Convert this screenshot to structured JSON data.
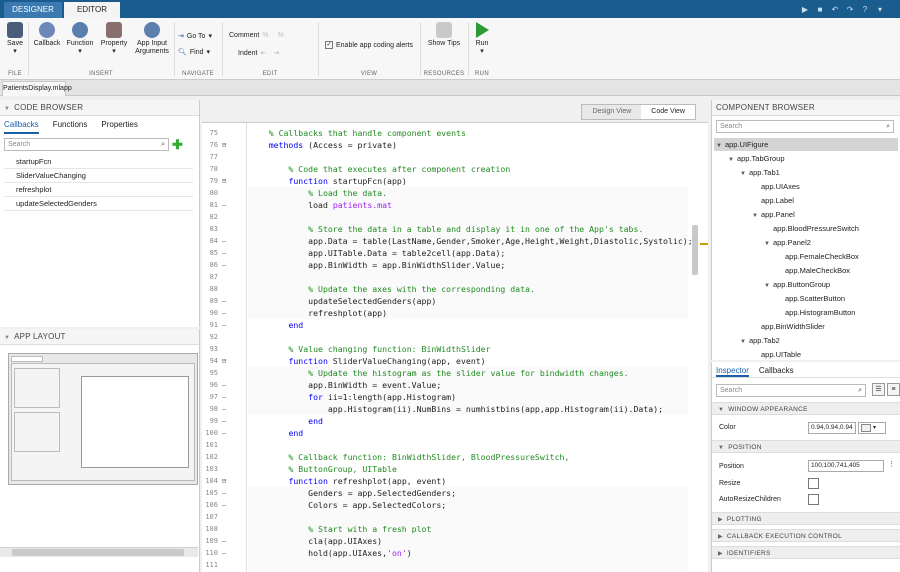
{
  "ribbon_tabs": {
    "designer": "DESIGNER",
    "editor": "EDITOR"
  },
  "ribbon": {
    "save": "Save",
    "callback": "Callback",
    "function": "Function",
    "property": "Property",
    "app_input_1": "App Input",
    "app_input_2": "Arguments",
    "go_to": "Go To",
    "find": "Find",
    "comment": "Comment",
    "indent": "Indent",
    "coding_alerts": "Enable app coding alerts",
    "show_tips": "Show Tips",
    "run": "Run",
    "groups": {
      "file": "FILE",
      "insert": "INSERT",
      "navigate": "NAVIGATE",
      "edit": "EDIT",
      "view": "VIEW",
      "resources": "RESOURCES",
      "run": "RUN"
    }
  },
  "document_tab": "PatientsDisplay.mlapp",
  "code_browser": {
    "title": "CODE BROWSER",
    "tabs": [
      "Callbacks",
      "Functions",
      "Properties"
    ],
    "search_placeholder": "Search",
    "items": [
      "startupFcn",
      "SliderValueChanging",
      "refreshplot",
      "updateSelectedGenders"
    ]
  },
  "app_layout": {
    "title": "APP LAYOUT"
  },
  "views": {
    "design": "Design View",
    "code": "Code View"
  },
  "code_lines": [
    {
      "n": "75",
      "t": "    % Callbacks that handle component events",
      "c": "cmt"
    },
    {
      "n": "76",
      "t": "    methods (Access = private)",
      "c": ""
    },
    {
      "n": "77",
      "t": "",
      "c": ""
    },
    {
      "n": "78",
      "t": "        % Code that executes after component creation",
      "c": "cmt"
    },
    {
      "n": "79",
      "t": "        function startupFcn(app)",
      "c": "fn"
    },
    {
      "n": "80",
      "t": "            % Load the data.",
      "c": "cmt"
    },
    {
      "n": "81",
      "t": "            load patients.mat",
      "c": "load"
    },
    {
      "n": "82",
      "t": "",
      "c": ""
    },
    {
      "n": "83",
      "t": "            % Store the data in a table and display it in one of the App's tabs.",
      "c": "cmt"
    },
    {
      "n": "84",
      "t": "            app.Data = table(LastName,Gender,Smoker,Age,Height,Weight,Diastolic,Systolic);",
      "c": ""
    },
    {
      "n": "85",
      "t": "            app.UITable.Data = table2cell(app.Data);",
      "c": ""
    },
    {
      "n": "86",
      "t": "            app.BinWidth = app.BinWidthSlider.Value;",
      "c": ""
    },
    {
      "n": "87",
      "t": "",
      "c": ""
    },
    {
      "n": "88",
      "t": "            % Update the axes with the corresponding data.",
      "c": "cmt"
    },
    {
      "n": "89",
      "t": "            updateSelectedGenders(app)",
      "c": ""
    },
    {
      "n": "90",
      "t": "            refreshplot(app)",
      "c": ""
    },
    {
      "n": "91",
      "t": "        end",
      "c": "kw"
    },
    {
      "n": "92",
      "t": "",
      "c": ""
    },
    {
      "n": "93",
      "t": "        % Value changing function: BinWidthSlider",
      "c": "cmt"
    },
    {
      "n": "94",
      "t": "        function SliderValueChanging(app, event)",
      "c": "fn"
    },
    {
      "n": "95",
      "t": "            % Update the histogram as the slider value for bindwidth changes.",
      "c": "cmt"
    },
    {
      "n": "96",
      "t": "            app.BinWidth = event.Value;",
      "c": ""
    },
    {
      "n": "97",
      "t": "            for ii=1:length(app.Histogram)",
      "c": "for"
    },
    {
      "n": "98",
      "t": "                app.Histogram(ii).NumBins = numhistbins(app,app.Histogram(ii).Data);",
      "c": ""
    },
    {
      "n": "99",
      "t": "            end",
      "c": "kw"
    },
    {
      "n": "100",
      "t": "        end",
      "c": "kw"
    },
    {
      "n": "101",
      "t": "",
      "c": ""
    },
    {
      "n": "102",
      "t": "        % Callback function: BinWidthSlider, BloodPressureSwitch,",
      "c": "cmt"
    },
    {
      "n": "103",
      "t": "        % ButtonGroup, UITable",
      "c": "cmt"
    },
    {
      "n": "104",
      "t": "        function refreshplot(app, event)",
      "c": "fn"
    },
    {
      "n": "105",
      "t": "            Genders = app.SelectedGenders;",
      "c": ""
    },
    {
      "n": "106",
      "t": "            Colors = app.SelectedColors;",
      "c": ""
    },
    {
      "n": "107",
      "t": "",
      "c": ""
    },
    {
      "n": "108",
      "t": "            % Start with a fresh plot",
      "c": "cmt"
    },
    {
      "n": "109",
      "t": "            cla(app.UIAxes)",
      "c": ""
    },
    {
      "n": "110",
      "t": "            hold(app.UIAxes,'on')",
      "c": "hold"
    },
    {
      "n": "111",
      "t": "",
      "c": ""
    }
  ],
  "component_browser": {
    "title": "COMPONENT BROWSER",
    "search_placeholder": "Search",
    "tree": [
      {
        "label": "app.UIFigure",
        "level": 0,
        "expanded": true
      },
      {
        "label": "app.TabGroup",
        "level": 1,
        "expanded": true
      },
      {
        "label": "app.Tab1",
        "level": 2,
        "expanded": true
      },
      {
        "label": "app.UIAxes",
        "level": 3
      },
      {
        "label": "app.Label",
        "level": 3
      },
      {
        "label": "app.Panel",
        "level": 3,
        "expanded": true
      },
      {
        "label": "app.BloodPressureSwitch",
        "level": 4
      },
      {
        "label": "app.Panel2",
        "level": 4,
        "expanded": true
      },
      {
        "label": "app.FemaleCheckBox",
        "level": 5
      },
      {
        "label": "app.MaleCheckBox",
        "level": 5
      },
      {
        "label": "app.ButtonGroup",
        "level": 4,
        "expanded": true
      },
      {
        "label": "app.ScatterButton",
        "level": 5
      },
      {
        "label": "app.HistogramButton",
        "level": 5
      },
      {
        "label": "app.BinWidthSlider",
        "level": 3
      },
      {
        "label": "app.Tab2",
        "level": 2,
        "expanded": true
      },
      {
        "label": "app.UITable",
        "level": 3
      }
    ]
  },
  "inspector": {
    "tabs": [
      "Inspector",
      "Callbacks"
    ],
    "search_placeholder": "Search",
    "sections": {
      "window_appearance": "WINDOW APPEARANCE",
      "position": "POSITION",
      "plotting": "PLOTTING",
      "callback_execution": "CALLBACK EXECUTION CONTROL",
      "identifiers": "IDENTIFIERS"
    },
    "color_label": "Color",
    "color_value": "0.94,0.94,0.94",
    "position_label": "Position",
    "position_value": "100,100,741,405",
    "resize_label": "Resize",
    "auto_resize_label": "AutoResizeChildren"
  },
  "colors": {
    "accent": "#1a5ea8",
    "ribbon_bar": "#1b5c8f",
    "comment": "#228b22",
    "keyword": "#0000ff",
    "string": "#a020f0"
  }
}
